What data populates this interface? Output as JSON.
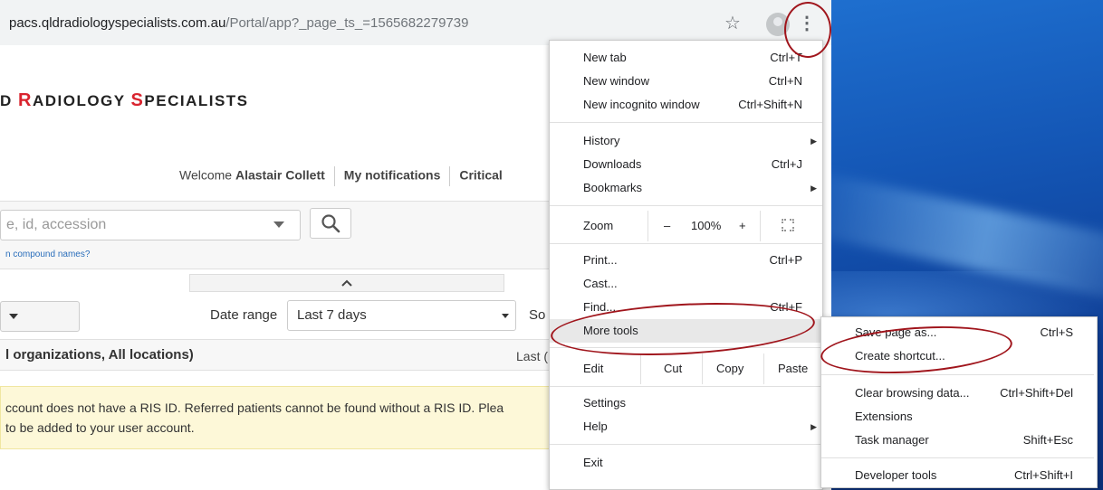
{
  "browser": {
    "url_host": "pacs.qldradiologyspecialists.com.au",
    "url_path": "/Portal/app?_page_ts_=1565682279739",
    "star_icon": "star-icon",
    "menu_icon": "kebab-menu-icon"
  },
  "page": {
    "logo_parts": [
      "D ",
      "R",
      "ADIOLOGY ",
      "S",
      "PECIALISTS"
    ],
    "welcome_prefix": "Welcome",
    "user_name": "Alastair Collett",
    "notifications": "My notifications",
    "critical": "Critical",
    "search_placeholder": "e, id, accession",
    "search_hint": "n compound names?",
    "collapse_glyph": "^",
    "date_range_label": "Date range",
    "date_range_value": "Last 7 days",
    "sort_label_partial": "So",
    "org_text": "l organizations, All locations)",
    "last_label_partial": "Last (",
    "notice_line1": "ccount does not have a RIS ID. Referred patients cannot be found without a RIS ID. Plea",
    "notice_line2": "to be added to your user account."
  },
  "menu": {
    "new_tab": {
      "label": "New tab",
      "shortcut": "Ctrl+T"
    },
    "new_window": {
      "label": "New window",
      "shortcut": "Ctrl+N"
    },
    "new_incognito": {
      "label": "New incognito window",
      "shortcut": "Ctrl+Shift+N"
    },
    "history": {
      "label": "History"
    },
    "downloads": {
      "label": "Downloads",
      "shortcut": "Ctrl+J"
    },
    "bookmarks": {
      "label": "Bookmarks"
    },
    "zoom": {
      "label": "Zoom",
      "minus": "–",
      "value": "100%",
      "plus": "+",
      "fullscreen_icon": "fullscreen-icon"
    },
    "print": {
      "label": "Print...",
      "shortcut": "Ctrl+P"
    },
    "cast": {
      "label": "Cast..."
    },
    "find": {
      "label": "Find...",
      "shortcut": "Ctrl+F"
    },
    "more_tools": {
      "label": "More tools"
    },
    "edit": {
      "label": "Edit",
      "cut": "Cut",
      "copy": "Copy",
      "paste": "Paste"
    },
    "settings": {
      "label": "Settings"
    },
    "help": {
      "label": "Help"
    },
    "exit": {
      "label": "Exit"
    }
  },
  "submenu": {
    "save_page": {
      "label": "Save page as...",
      "shortcut": "Ctrl+S"
    },
    "create_shortcut": {
      "label": "Create shortcut..."
    },
    "clear_data": {
      "label": "Clear browsing data...",
      "shortcut": "Ctrl+Shift+Del"
    },
    "extensions": {
      "label": "Extensions"
    },
    "task_manager": {
      "label": "Task manager",
      "shortcut": "Shift+Esc"
    },
    "dev_tools": {
      "label": "Developer tools",
      "shortcut": "Ctrl+Shift+I"
    }
  },
  "colors": {
    "annotation_red": "#a0151c",
    "logo_red": "#d9232e",
    "desktop_blue": "#1456b5"
  }
}
